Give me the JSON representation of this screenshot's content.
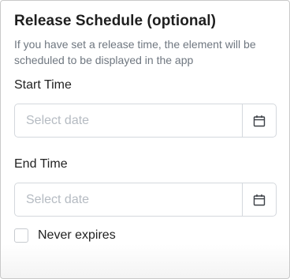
{
  "release_schedule": {
    "title": "Release Schedule (optional)",
    "description": "If you have set a release time, the element will be scheduled to be displayed in the app",
    "start_time": {
      "label": "Start Time",
      "placeholder": "Select date",
      "value": "",
      "icon": "calendar-icon"
    },
    "end_time": {
      "label": "End Time",
      "placeholder": "Select date",
      "value": "",
      "icon": "calendar-icon"
    },
    "never_expires": {
      "label": "Never expires",
      "checked": false
    }
  },
  "colors": {
    "title": "#1f1f1f",
    "description": "#6f7780",
    "label": "#222222",
    "placeholder": "#b5bbc2",
    "border": "#d4d8dd"
  }
}
